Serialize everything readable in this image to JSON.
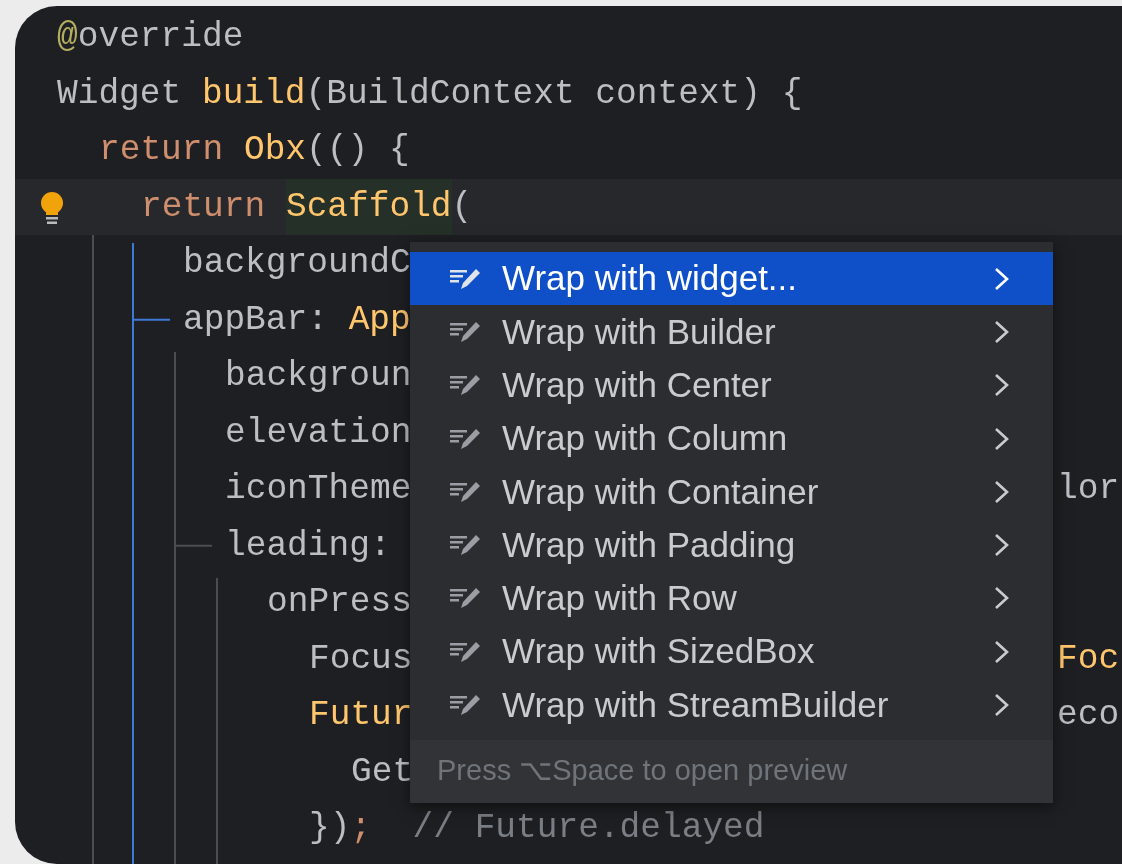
{
  "editor": {
    "lines": [
      {
        "current": false,
        "bulb": false,
        "tokens": [
          {
            "kind": "annotation",
            "text": "@"
          },
          {
            "kind": "plain",
            "text": "override"
          }
        ]
      },
      {
        "current": false,
        "bulb": false,
        "tokens": [
          {
            "kind": "plain",
            "text": "Widget "
          },
          {
            "kind": "type",
            "text": "build"
          },
          {
            "kind": "plain",
            "text": "(BuildContext context) {"
          }
        ],
        "children": [
          {
            "current": false,
            "bulb": false,
            "tokens": [
              {
                "kind": "keyword",
                "text": "return "
              },
              {
                "kind": "type",
                "text": "Obx"
              },
              {
                "kind": "plain",
                "text": "(() {"
              }
            ],
            "children": [
              {
                "current": true,
                "bulb": true,
                "tokens": [
                  {
                    "kind": "keyword",
                    "text": "return "
                  },
                  {
                    "kind": "match",
                    "text": "Scaffold"
                  },
                  {
                    "kind": "plain",
                    "text": "("
                  }
                ],
                "children": [
                  {
                    "current": false,
                    "bulb": false,
                    "tokens": [
                      {
                        "kind": "plain",
                        "text": "backgroundC"
                      }
                    ]
                  },
                  {
                    "current": false,
                    "bulb": false,
                    "tokens": [
                      {
                        "kind": "plain",
                        "text": "appBar: "
                      },
                      {
                        "kind": "type",
                        "text": "App"
                      }
                    ],
                    "children": [
                      {
                        "current": false,
                        "bulb": false,
                        "tokens": [
                          {
                            "kind": "plain",
                            "text": "backgroun"
                          }
                        ]
                      },
                      {
                        "current": false,
                        "bulb": false,
                        "tokens": [
                          {
                            "kind": "plain",
                            "text": "elevation"
                          }
                        ]
                      },
                      {
                        "current": false,
                        "bulb": false,
                        "tokens": [
                          {
                            "kind": "plain",
                            "text": "iconTheme"
                          }
                        ],
                        "after_popup": [
                          {
                            "kind": "plain",
                            "text": "lor"
                          }
                        ]
                      },
                      {
                        "current": false,
                        "bulb": false,
                        "tokens": [
                          {
                            "kind": "plain",
                            "text": "leading:"
                          }
                        ],
                        "children": [
                          {
                            "current": false,
                            "bulb": false,
                            "tokens": [
                              {
                                "kind": "plain",
                                "text": "onPress"
                              }
                            ],
                            "children": [
                              {
                                "current": false,
                                "bulb": false,
                                "tokens": [
                                  {
                                    "kind": "plain",
                                    "text": "Focus"
                                  }
                                ],
                                "after_popup": [
                                  {
                                    "kind": "type",
                                    "text": "Foc"
                                  }
                                ]
                              },
                              {
                                "current": false,
                                "bulb": false,
                                "tokens": [
                                  {
                                    "kind": "type",
                                    "text": "Futur"
                                  }
                                ],
                                "after_popup": [
                                  {
                                    "kind": "plain",
                                    "text": "eco"
                                  }
                                ],
                                "children": [
                                  {
                                    "current": false,
                                    "bulb": false,
                                    "tokens": [
                                      {
                                        "kind": "plain",
                                        "text": "Get"
                                      }
                                    ]
                                  }
                                ]
                              },
                              {
                                "current": false,
                                "bulb": false,
                                "tokens": [
                                  {
                                    "kind": "plain",
                                    "text": "})"
                                  },
                                  {
                                    "kind": "keyword",
                                    "text": ";"
                                  },
                                  {
                                    "kind": "comment",
                                    "text": "// Future.delayed"
                                  }
                                ]
                              }
                            ]
                          }
                        ]
                      }
                    ]
                  }
                ]
              }
            ]
          }
        ]
      }
    ]
  },
  "intention_popup": {
    "items": [
      {
        "label": "Wrap with widget...",
        "selected": true,
        "submenu": true
      },
      {
        "label": "Wrap with Builder",
        "selected": false,
        "submenu": true
      },
      {
        "label": "Wrap with Center",
        "selected": false,
        "submenu": true
      },
      {
        "label": "Wrap with Column",
        "selected": false,
        "submenu": true
      },
      {
        "label": "Wrap with Container",
        "selected": false,
        "submenu": true
      },
      {
        "label": "Wrap with Padding",
        "selected": false,
        "submenu": true
      },
      {
        "label": "Wrap with Row",
        "selected": false,
        "submenu": true
      },
      {
        "label": "Wrap with SizedBox",
        "selected": false,
        "submenu": true
      },
      {
        "label": "Wrap with StreamBuilder",
        "selected": false,
        "submenu": true
      }
    ],
    "footer": "Press ⌥Space to open preview"
  }
}
